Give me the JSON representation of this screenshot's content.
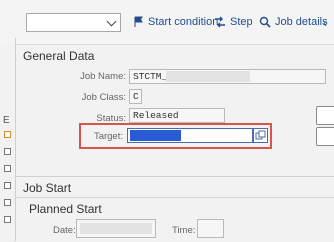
{
  "toolbar": {
    "select_value": "",
    "start_condition": "Start condition",
    "step": "Step",
    "job_details": "Job details",
    "more": "‹"
  },
  "general": {
    "title": "General Data",
    "job_name_label": "Job Name:",
    "job_name_value": "STCTM_",
    "job_class_label": "Job Class:",
    "job_class_value": "C",
    "status_label": "Status:",
    "status_value": "Released",
    "target_label": "Target:"
  },
  "side_letter": "E",
  "job_start": {
    "title": "Job Start",
    "planned_start": "Planned Start",
    "date_label": "Date:",
    "time_label": "Time:"
  }
}
